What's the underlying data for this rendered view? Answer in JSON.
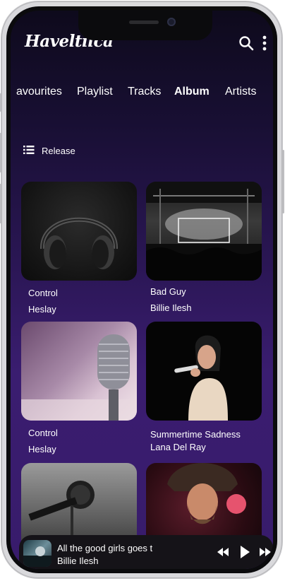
{
  "app": {
    "brand": "Haveltiica"
  },
  "tabs": [
    "avourites",
    "Playlist",
    "Tracks",
    "Album",
    "Artists"
  ],
  "active_tab": "Album",
  "sort": {
    "label": "Release",
    "icon": "list-icon"
  },
  "albums": [
    {
      "title": "Control",
      "artist": "Heslay"
    },
    {
      "title": "Bad Guy",
      "artist": "Billie Ilesh"
    },
    {
      "title": "Control",
      "artist": "Heslay"
    },
    {
      "title": "Summertime Sadness",
      "artist": "Lana Del Ray"
    },
    {
      "title": "",
      "artist": ""
    },
    {
      "title": "",
      "artist": ""
    }
  ],
  "player": {
    "title": "All the good girls goes t",
    "artist": "Billie Ilesh",
    "controls": [
      "previous-icon",
      "play-icon",
      "next-icon"
    ]
  },
  "colors": {
    "bg_top": "#0e0a1c",
    "bg_bottom": "#381b6b",
    "text": "#ffffff",
    "player_bg": "#151318"
  }
}
